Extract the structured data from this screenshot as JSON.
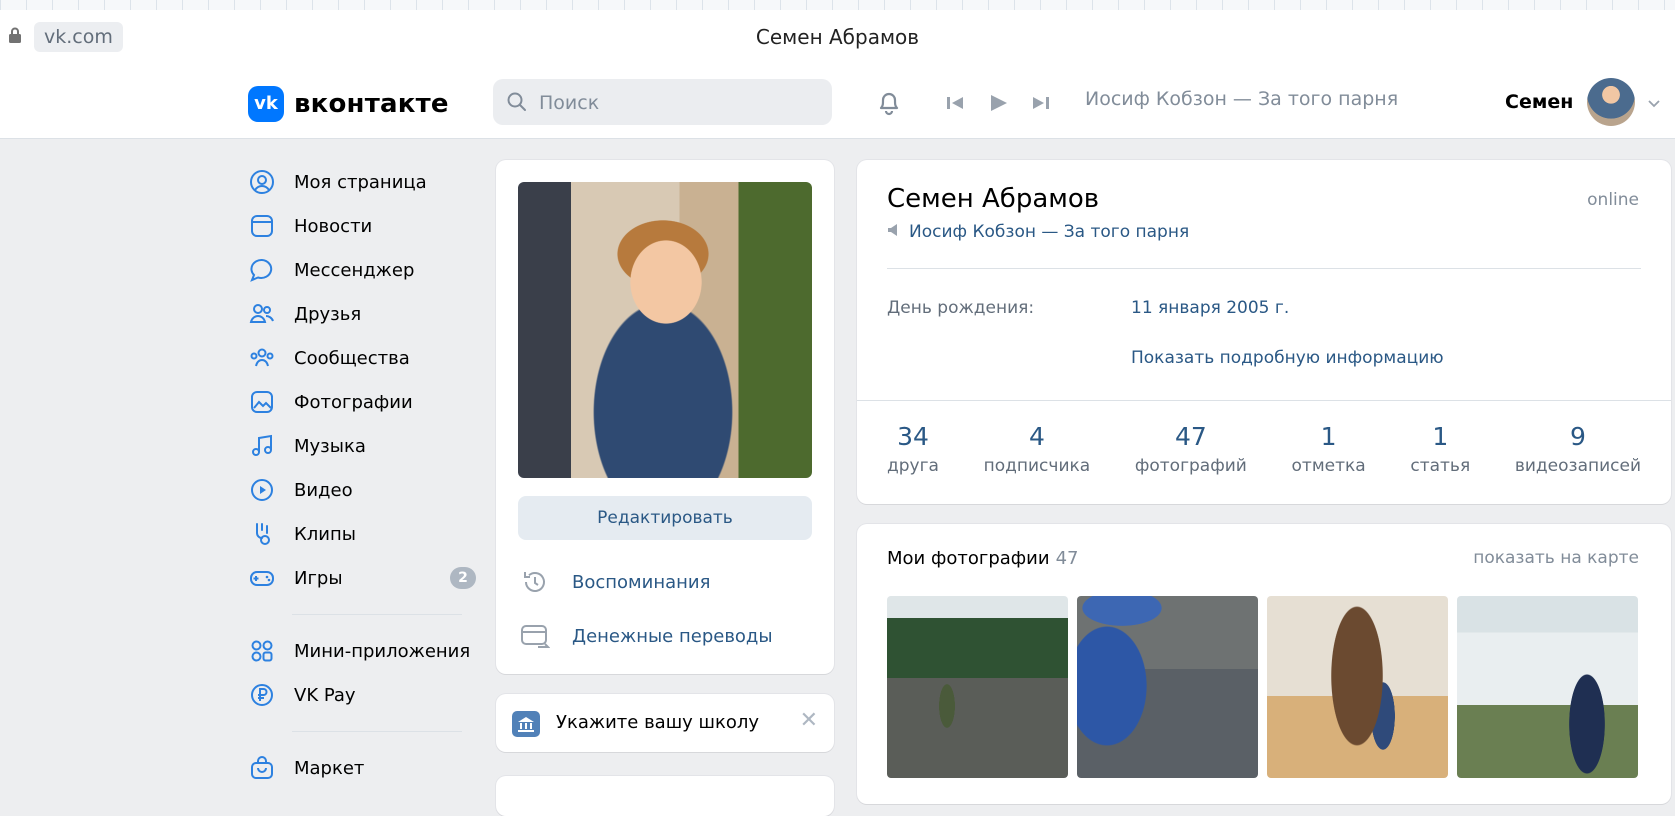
{
  "browser": {
    "url": "vk.com",
    "window_title": "Семен Абрамов"
  },
  "header": {
    "logo_text": "вконтакте",
    "search_placeholder": "Поиск",
    "now_playing": "Иосиф Кобзон — За того парня",
    "user_name": "Семен"
  },
  "sidebar": {
    "items": [
      {
        "label": "Моя страница",
        "icon": "user-circle-icon"
      },
      {
        "label": "Новости",
        "icon": "news-icon"
      },
      {
        "label": "Мессенджер",
        "icon": "message-icon"
      },
      {
        "label": "Друзья",
        "icon": "friends-icon"
      },
      {
        "label": "Сообщества",
        "icon": "communities-icon"
      },
      {
        "label": "Фотографии",
        "icon": "photo-icon"
      },
      {
        "label": "Музыка",
        "icon": "music-icon"
      },
      {
        "label": "Видео",
        "icon": "video-icon"
      },
      {
        "label": "Клипы",
        "icon": "clips-icon"
      },
      {
        "label": "Игры",
        "icon": "games-icon",
        "badge": "2"
      },
      {
        "label": "Мини-приложения",
        "icon": "apps-icon"
      },
      {
        "label": "VK Pay",
        "icon": "vkpay-icon"
      },
      {
        "label": "Маркет",
        "icon": "market-icon"
      }
    ]
  },
  "profile_photo_card": {
    "edit_button": "Редактировать",
    "links": [
      {
        "label": "Воспоминания",
        "icon": "history-icon"
      },
      {
        "label": "Денежные переводы",
        "icon": "money-transfer-icon"
      }
    ]
  },
  "school_card": {
    "text": "Укажите вашу школу"
  },
  "profile": {
    "name": "Семен Абрамов",
    "online": "online",
    "status": "Иосиф Кобзон — За того парня",
    "birthday_label": "День рождения:",
    "birthday_value": "11 января 2005 г.",
    "more_info": "Показать подробную информацию",
    "counters": [
      {
        "value": "34",
        "label": "друга"
      },
      {
        "value": "4",
        "label": "подписчика"
      },
      {
        "value": "47",
        "label": "фотографий"
      },
      {
        "value": "1",
        "label": "отметка"
      },
      {
        "value": "1",
        "label": "статья"
      },
      {
        "value": "9",
        "label": "видеозаписей"
      }
    ]
  },
  "photos": {
    "title": "Мои фотографии",
    "count": "47",
    "map_link": "показать на карте"
  },
  "colors": {
    "accent": "#0077ff",
    "link": "#2a5885",
    "background": "#edeef0",
    "muted": "#818c99"
  }
}
